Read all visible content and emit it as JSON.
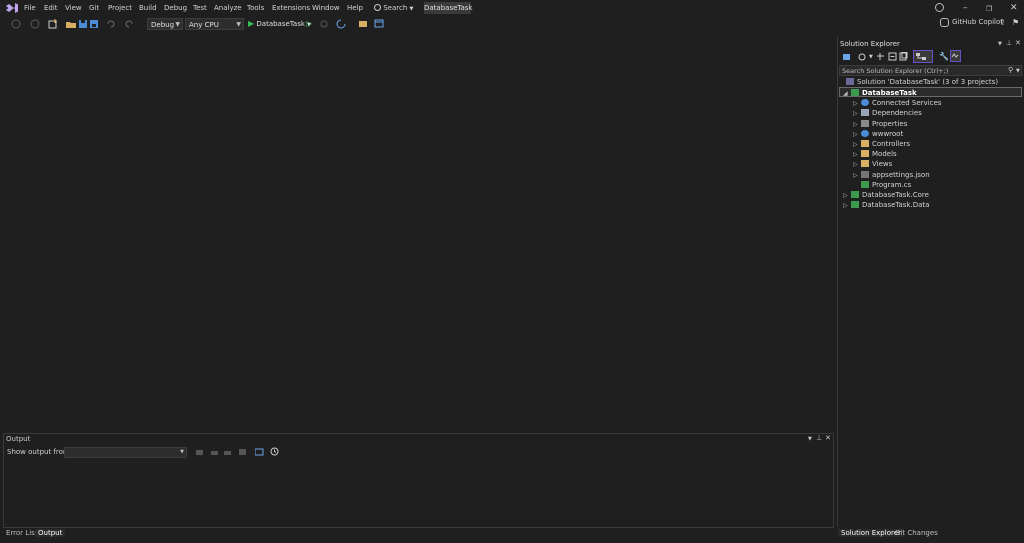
{
  "menu": [
    "File",
    "Edit",
    "View",
    "Git",
    "Project",
    "Build",
    "Debug",
    "Test",
    "Analyze",
    "Tools",
    "Extensions",
    "Window",
    "Help"
  ],
  "search": {
    "label": "Search"
  },
  "solution_badge": "DatabaseTask",
  "toolbar": {
    "config": "Debug",
    "platform": "Any CPU",
    "run_target": "DatabaseTask"
  },
  "copilot": {
    "label": "GitHub Copilot"
  },
  "output": {
    "title": "Output",
    "show_from_label": "Show output from:",
    "source_value": ""
  },
  "bottom_tabs": [
    {
      "label": "Error List",
      "active": false
    },
    {
      "label": "Output",
      "active": true
    }
  ],
  "solution_explorer": {
    "title": "Solution Explorer",
    "search_placeholder": "Search Solution Explorer (Ctrl+;)",
    "solution_line": "Solution 'DatabaseTask' (3 of 3 projects)",
    "tree": [
      {
        "label": "DatabaseTask",
        "level": 1,
        "expanded": true,
        "icon": "csharp-project-icon",
        "bold": true,
        "selected": true
      },
      {
        "label": "Connected Services",
        "level": 2,
        "icon": "connected-services-icon"
      },
      {
        "label": "Dependencies",
        "level": 2,
        "icon": "dependencies-icon"
      },
      {
        "label": "Properties",
        "level": 2,
        "icon": "properties-icon"
      },
      {
        "label": "wwwroot",
        "level": 2,
        "icon": "globe-icon"
      },
      {
        "label": "Controllers",
        "level": 2,
        "icon": "folder-icon"
      },
      {
        "label": "Models",
        "level": 2,
        "icon": "folder-icon"
      },
      {
        "label": "Views",
        "level": 2,
        "icon": "folder-icon"
      },
      {
        "label": "appsettings.json",
        "level": 2,
        "icon": "json-file-icon"
      },
      {
        "label": "Program.cs",
        "level": 2,
        "icon": "csharp-file-icon",
        "no_expander": true
      },
      {
        "label": "DatabaseTask.Core",
        "level": 1,
        "icon": "csharp-project-icon"
      },
      {
        "label": "DatabaseTask.Data",
        "level": 1,
        "icon": "csharp-project-icon"
      }
    ],
    "tabs": [
      {
        "label": "Solution Explorer",
        "active": true
      },
      {
        "label": "Git Changes",
        "active": false
      }
    ]
  },
  "colors": {
    "background": "#1f1f1f",
    "accent_purple": "#6c4ec7",
    "run_green": "#3dbb5a",
    "folder_yellow": "#d7b064",
    "project_green": "#3c9a4e"
  }
}
